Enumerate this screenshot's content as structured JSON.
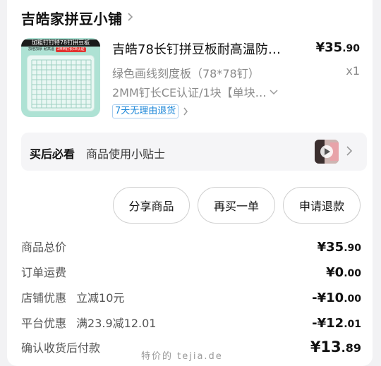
{
  "store": {
    "name": "吉皓家拼豆小铺"
  },
  "product": {
    "thumb_banner": "加粗钉钉特78钉拼豆板",
    "thumb_tags": [
      "加倍加厚",
      "耐高温",
      "2MM钉长CE认证"
    ],
    "title": "吉皓78长钉拼豆板耐高温防…",
    "price_main": "¥35",
    "price_dec": ".90",
    "variant": "绿色画线刻度板（78*78钉）",
    "quantity": "x1",
    "spec": "2MM钉长CE认证/1块【单块…",
    "return_badge": "7天无理由退货"
  },
  "tips": {
    "title": "买后必看",
    "text": "商品使用小贴士"
  },
  "actions": {
    "share": "分享商品",
    "rebuy": "再买一单",
    "refund": "申请退款"
  },
  "summary": [
    {
      "label": "商品总价",
      "sub": "",
      "main": "¥35",
      "dec": ".90"
    },
    {
      "label": "订单运费",
      "sub": "",
      "main": "¥0",
      "dec": ".00"
    },
    {
      "label": "店铺优惠",
      "sub": "立减10元",
      "main": "-¥10",
      "dec": ".00"
    },
    {
      "label": "平台优惠",
      "sub": "满23.9减12.01",
      "main": "-¥12",
      "dec": ".01"
    },
    {
      "label": "确认收货后付款",
      "sub": "",
      "main": "¥13",
      "dec": ".89"
    }
  ],
  "watermark": "特价的 tejia.de",
  "colors": {
    "badge_blue": "#1a86d8",
    "thumb_green": "#aee2d4"
  }
}
